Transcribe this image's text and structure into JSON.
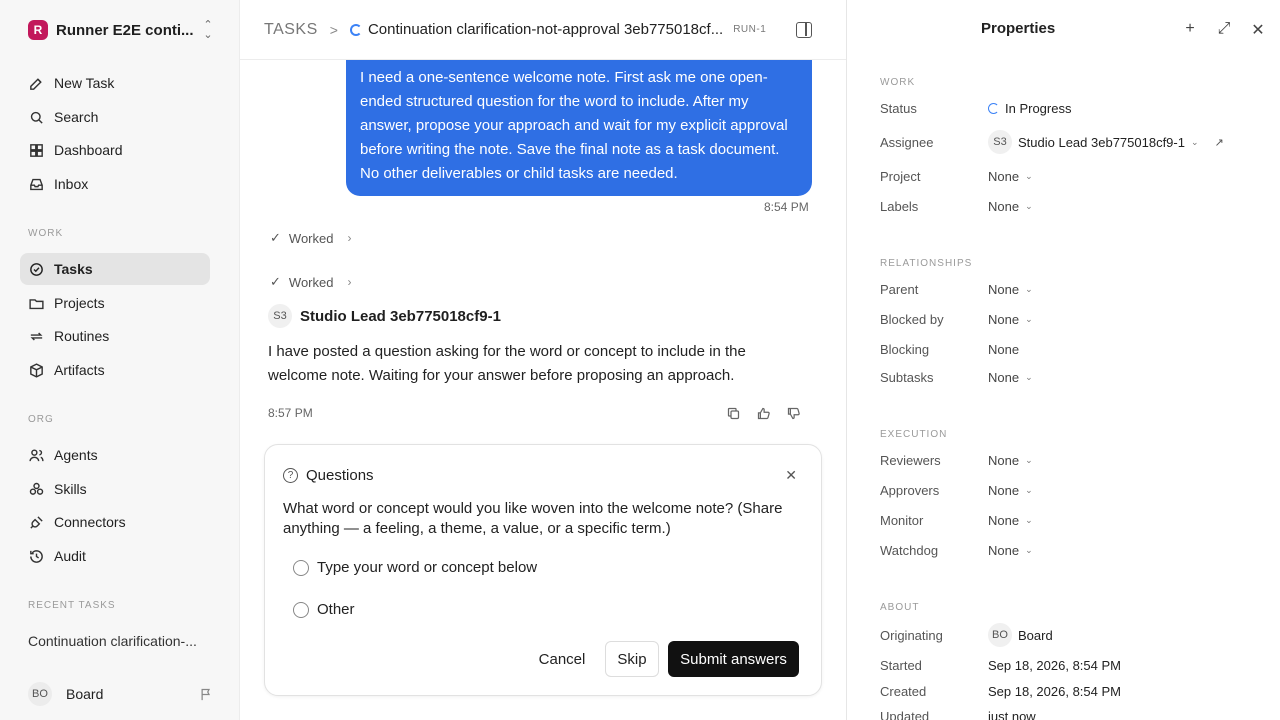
{
  "workspace": {
    "logo": "R",
    "name": "Runner E2E conti..."
  },
  "nav": {
    "new_task": "New Task",
    "search": "Search",
    "dashboard": "Dashboard",
    "inbox": "Inbox",
    "work_label": "WORK",
    "tasks": "Tasks",
    "projects": "Projects",
    "routines": "Routines",
    "artifacts": "Artifacts",
    "org_label": "ORG",
    "agents": "Agents",
    "skills": "Skills",
    "connectors": "Connectors",
    "audit": "Audit",
    "recent_label": "RECENT TASKS",
    "recent_task": "Continuation clarification-..."
  },
  "user": {
    "initials": "BO",
    "name": "Board"
  },
  "header": {
    "crumb": "TASKS",
    "task_title": "Continuation clarification-not-approval 3eb775018cf...",
    "run_id": "RUN-1"
  },
  "chat": {
    "user_message": "I need a one-sentence welcome note. First ask me one open-ended structured question for the word to include. After my answer, propose your approach and wait for my explicit approval before writing the note. Save the final note as a task document. No other deliverables or child tasks are needed.",
    "user_time": "8:54 PM",
    "worked_1": "Worked",
    "worked_2": "Worked",
    "agent_initials": "S3",
    "agent_name": "Studio Lead 3eb775018cf9-1",
    "agent_message": "I have posted a question asking for the word or concept to include in the welcome note. Waiting for your answer before proposing an approach.",
    "agent_time": "8:57 PM"
  },
  "questions": {
    "title": "Questions",
    "question": "What word or concept would you like woven into the welcome note? (Share anything — a feeling, a theme, a value, or a specific term.)",
    "option_1": "Type your word or concept below",
    "option_2": "Other",
    "cancel": "Cancel",
    "skip": "Skip",
    "submit": "Submit answers"
  },
  "properties": {
    "title": "Properties",
    "work_label": "WORK",
    "status_label": "Status",
    "status": "In Progress",
    "assignee_label": "Assignee",
    "assignee_initials": "S3",
    "assignee": "Studio Lead 3eb775018cf9-1",
    "project_label": "Project",
    "project": "None",
    "labels_label": "Labels",
    "labels": "None",
    "rel_label": "RELATIONSHIPS",
    "parent_label": "Parent",
    "parent": "None",
    "blocked_by_label": "Blocked by",
    "blocked_by": "None",
    "blocking_label": "Blocking",
    "blocking": "None",
    "subtasks_label": "Subtasks",
    "subtasks": "None",
    "exec_label": "EXECUTION",
    "reviewers_label": "Reviewers",
    "reviewers": "None",
    "approvers_label": "Approvers",
    "approvers": "None",
    "monitor_label": "Monitor",
    "monitor": "None",
    "watchdog_label": "Watchdog",
    "watchdog": "None",
    "about_label": "ABOUT",
    "originating_label": "Originating",
    "originating_initials": "BO",
    "originating": "Board",
    "started_label": "Started",
    "started": "Sep 18, 2026, 8:54 PM",
    "created_label": "Created",
    "created": "Sep 18, 2026, 8:54 PM",
    "updated_label": "Updated",
    "updated": "just now"
  },
  "colors": {
    "accent": "#2f6fe4",
    "submit": "#111111",
    "logo": "#c2185b"
  }
}
